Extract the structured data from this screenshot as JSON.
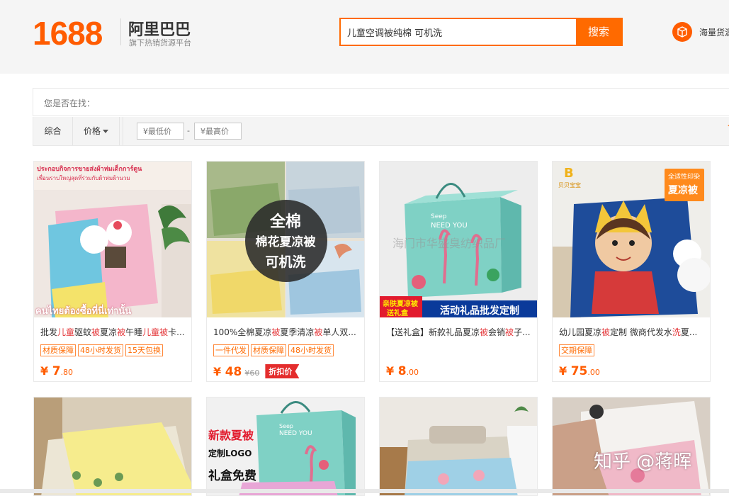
{
  "header": {
    "logo_number": "1688",
    "logo_name": "阿里巴巴",
    "logo_sub": "旗下热销货源平台",
    "search_value": "儿童空调被纯棉 可机洗",
    "search_button": "搜索",
    "mass_label": "海量货源"
  },
  "suggest": {
    "label": "您是否在找："
  },
  "filters": {
    "sort_default": "综合",
    "sort_price": "价格",
    "min_placeholder": "¥最低价",
    "dash": "-",
    "max_placeholder": "¥最高价",
    "edge": "↑"
  },
  "products": [
    {
      "title_parts": [
        "批发",
        "儿童",
        "驱蚊",
        "被",
        "夏凉",
        "被",
        "午睡",
        "儿童",
        "被",
        "卡..."
      ],
      "tags": [
        "材质保障",
        "48小时发货",
        "15天包换"
      ],
      "price_int": "7",
      "price_dec": ".80",
      "image_text": [
        "ประกอบกิจการขายส่งผ้าห่มเด็กการ์ตูน",
        "เพื่อนราบใหญ่สุดที่ร่วมกับผ้าห่มผ้านวม",
        "คนไทยต้องซื้อที่นี่เท่านั้น"
      ]
    },
    {
      "title_parts": [
        "100%全棉夏凉",
        "被",
        "夏季清凉",
        "被",
        "单人双..."
      ],
      "tags": [
        "一件代发",
        "材质保障",
        "48小时发货"
      ],
      "price_int": "48",
      "price_dec": "",
      "old_price": "¥60",
      "badge": "折扣价",
      "image_text": [
        "全棉",
        "棉花夏凉被",
        "可机洗"
      ]
    },
    {
      "title_parts": [
        "【送礼盒】新款礼品夏凉",
        "被",
        "会销",
        "被",
        "子..."
      ],
      "tags": [],
      "price_int": "8",
      "price_dec": ".00",
      "image_text": [
        "海门市华盛臭纺织品厂",
        "亲肤夏凉被",
        "送礼盒",
        "活动礼品批发定制",
        "Seep",
        "NEED YOU"
      ]
    },
    {
      "title_parts": [
        "幼儿园夏凉",
        "被",
        "定制 微商代发水",
        "洗",
        "夏..."
      ],
      "tags": [
        "交期保障"
      ],
      "price_int": "75",
      "price_dec": ".00",
      "image_text": [
        "全适性印染",
        "夏凉被",
        "B",
        "贝贝宝宝"
      ]
    }
  ],
  "row2": {
    "card2_text": [
      "新款夏被",
      "定制LOGO",
      "礼盒免费",
      "Seep",
      "NEED YOU"
    ]
  },
  "price_symbol": "¥",
  "watermark": "知乎 @蒋晖",
  "colors": {
    "accent": "#ff6a00",
    "highlight": "#e4393c",
    "header_bg": "#f5f5f5"
  }
}
